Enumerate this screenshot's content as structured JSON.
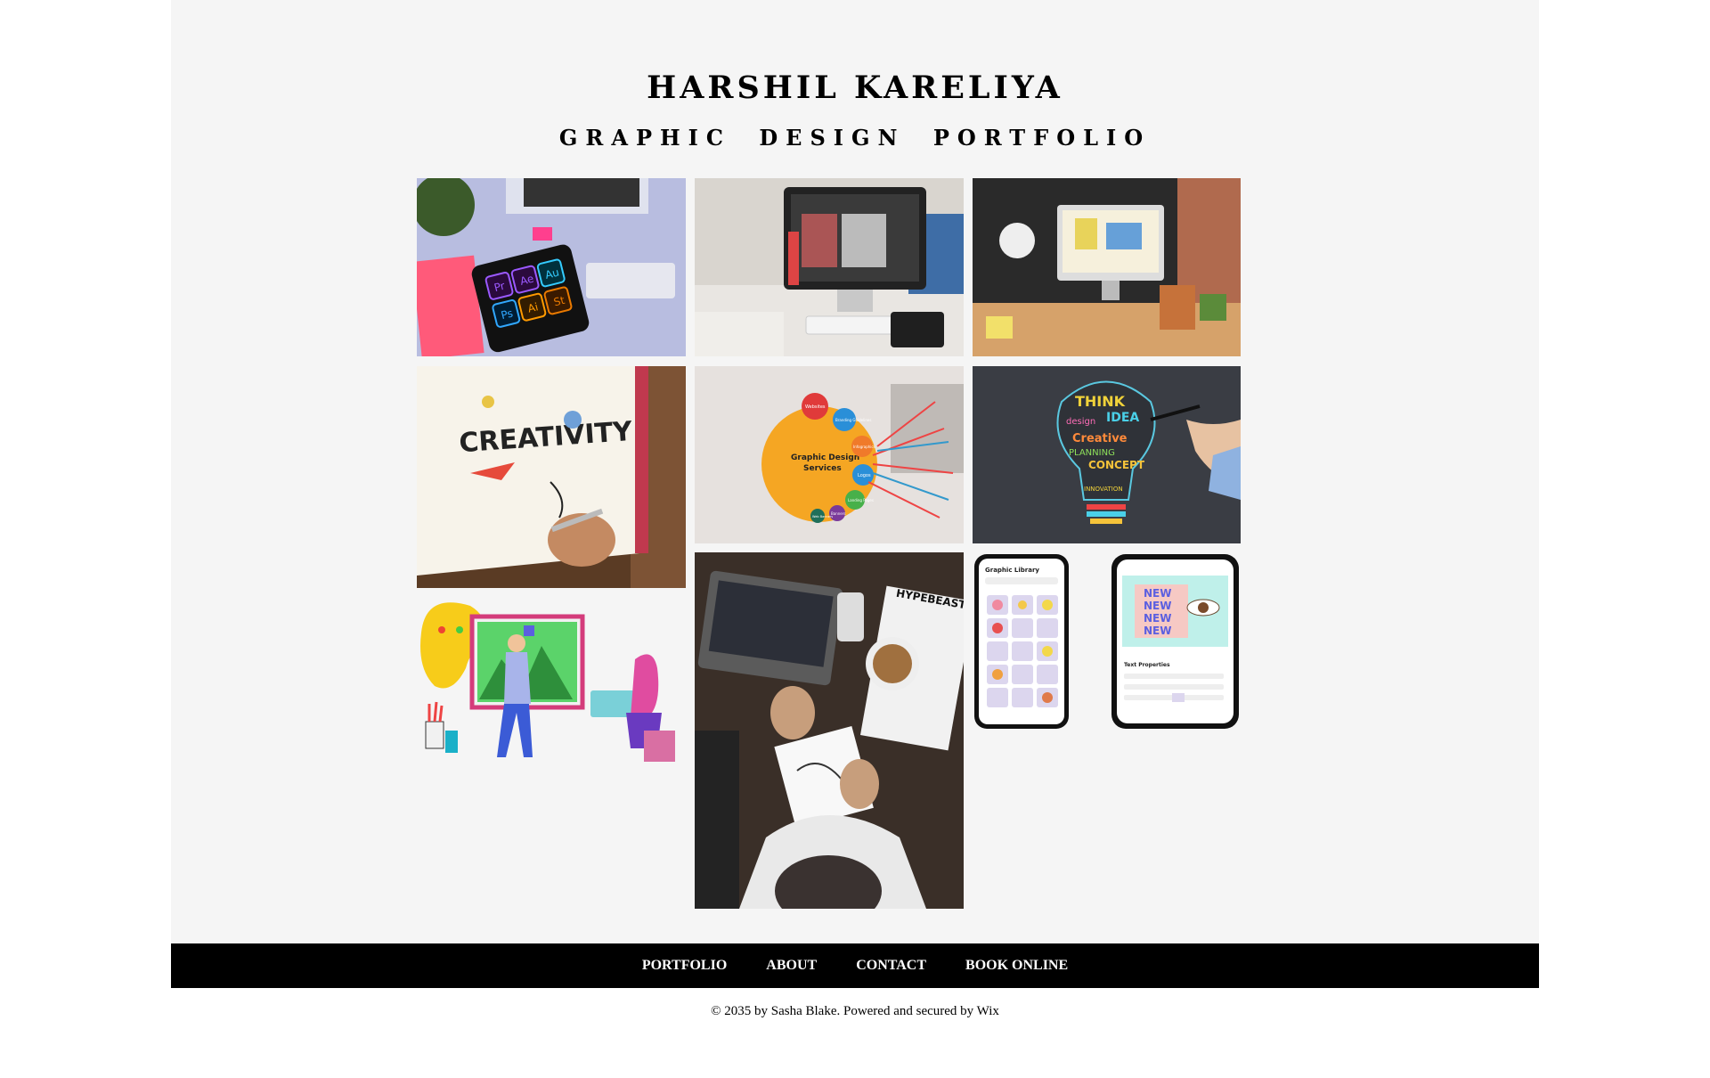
{
  "header": {
    "title": "HARSHIL KARELIYA",
    "subtitle": "GRAPHIC DESIGN PORTFOLIO"
  },
  "gallery": {
    "images": [
      {
        "name": "desk-tablet-adobe-apps",
        "icon": "photo"
      },
      {
        "name": "imac-design-workspace",
        "icon": "photo"
      },
      {
        "name": "design-studio-desk",
        "icon": "photo"
      },
      {
        "name": "creativity-sketchbook",
        "icon": "photo"
      },
      {
        "name": "graphic-design-services-diagram",
        "icon": "photo"
      },
      {
        "name": "think-idea-lightbulb",
        "icon": "photo"
      },
      {
        "name": "designers-illustration",
        "icon": "photo"
      },
      {
        "name": "laptop-coffee-topdown",
        "icon": "photo"
      },
      {
        "name": "phone-mockup-graphic-library",
        "icon": "photo"
      },
      {
        "name": "phone-mockup-text-properties",
        "icon": "photo"
      }
    ],
    "tile_text": {
      "tablet_apps": [
        "Pr",
        "Ae",
        "Au",
        "Ps",
        "Ai",
        "St"
      ],
      "sketchbook_word": "CREATIVITY",
      "services_title": "Graphic Design",
      "services_title2": "Services",
      "services_items": [
        "Websites",
        "Branding Guidelines",
        "Infographics",
        "Logos",
        "Landing Pages",
        "Banners",
        "Web Banners"
      ],
      "bulb_words": [
        "THINK",
        "IDEA",
        "design",
        "Creative",
        "PLANNING",
        "CONCEPT",
        "INNOVATION"
      ],
      "magazine": "HYPEBEAST",
      "phone1_title": "Graphic Library",
      "phone2_word": "NEW",
      "phone2_panel": "Text Properties"
    }
  },
  "nav": {
    "items": [
      "PORTFOLIO",
      "ABOUT",
      "CONTACT",
      "BOOK ONLINE"
    ]
  },
  "footer": {
    "copyright": "© 2035 by Sasha Blake. Powered and secured by Wix"
  },
  "colors": {
    "page_bg": "#f5f5f5",
    "footer_bg": "#000000",
    "footer_text": "#ffffff"
  }
}
